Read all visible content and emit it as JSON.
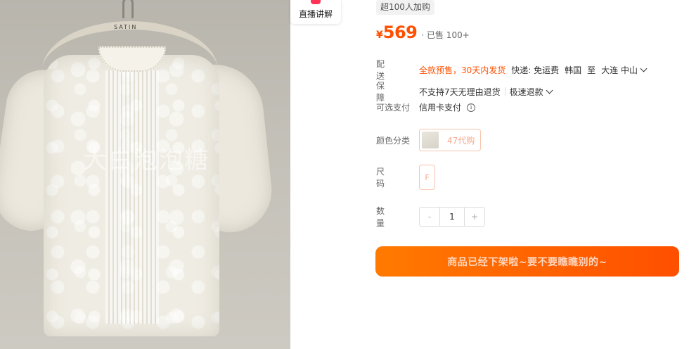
{
  "photo": {
    "hanger_brand": "SATIN",
    "watermark": "大白泡泡糖"
  },
  "live_badge": {
    "label": "直播讲解"
  },
  "info": {
    "tag": "超100人加购",
    "price_symbol": "¥",
    "price": "569",
    "sold": "· 已售 100+",
    "shipping": {
      "label": "配送",
      "presale": "全款预售，30天内发货",
      "carrier": "快递: 免运费",
      "origin": "韩国",
      "to": "至",
      "destination": "大连 中山"
    },
    "guarantee": {
      "label": "保障",
      "no_return": "不支持7天无理由退货",
      "refund": "极速退款"
    },
    "payment": {
      "label": "可选支付",
      "method": "信用卡支付"
    },
    "color": {
      "label": "颜色分类",
      "option": "47代购"
    },
    "size": {
      "label": "尺码",
      "option": "F"
    },
    "quantity": {
      "label": "数量",
      "minus": "-",
      "value": "1",
      "plus": "+"
    },
    "buy_button": "商品已经下架啦~要不要瞧瞧别的~"
  },
  "colors": {
    "accent": "#ff5000",
    "live": "#ff3355"
  }
}
